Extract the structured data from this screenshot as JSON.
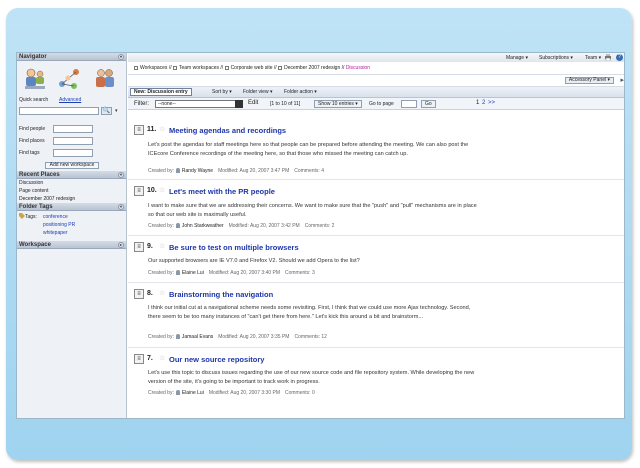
{
  "sidebar": {
    "navigator_title": "Navigator",
    "quick_search_label": "Quick search",
    "advanced_label": "Advanced",
    "search_button": "🔍",
    "find_people": "Find people",
    "find_places": "Find places",
    "find_tags": "Find tags",
    "add_workspace": "Add new workspace",
    "recent_places_title": "Recent Places",
    "recent_places": [
      "Discussion",
      "Page content",
      "December 2007 redesign"
    ],
    "folder_tags_title": "Folder Tags",
    "tags_label": "Tags:",
    "tags": [
      "conference",
      "positioning PR",
      "whitepaper"
    ],
    "workspace_title": "Workspace"
  },
  "topbar": {
    "manage": "Manage ▾",
    "subscriptions": "Subscriptions ▾",
    "team": "Team ▾",
    "help": "?"
  },
  "breadcrumb": {
    "items": [
      "Workspaces",
      "Team workspaces",
      "Corporate web site",
      "December 2007 redesign"
    ],
    "separator": "//",
    "current": "Discussion"
  },
  "accessory_panel": "Accessory Panel ▾",
  "toolbar": {
    "new_entry": "New: Discussion entry",
    "sort_by": "Sort by ▾",
    "folder_view": "Folder view ▾",
    "folder_action": "Folder action ▾"
  },
  "filter": {
    "label": "Filter:",
    "select_value": "--none--",
    "edit": "Edit",
    "range": "[1 to 10 of 11]",
    "show": "Show 10 entries ▾",
    "go_to_page": "Go to page",
    "go_button": "Go",
    "page_current": "1",
    "page_next": "2",
    "page_more": ">>"
  },
  "entries": [
    {
      "num": "11.",
      "title": "Meeting agendas and recordings",
      "body": "Let's post the agendas for staff meetings here so that people can be prepared before attending the meeting. We can also post the ICEcore Conference recordings of the meeting here, so that those who missed the meeting can catch up.",
      "created_by": "Created by:",
      "author": "Randy Wayne",
      "modified": "Modified: Aug 20, 2007 3:47 PM",
      "comments": "Comments: 4"
    },
    {
      "num": "10.",
      "title": "Let's meet with the PR people",
      "body": "I want to make sure that we are addressing their concerns. We want to make sure that the \"push\" and \"pull\" mechanisms are in place so that our web site is maximally useful.",
      "created_by": "Created by:",
      "author": "John Starkweather",
      "modified": "Modified: Aug 20, 2007 3:42 PM",
      "comments": "Comments: 2"
    },
    {
      "num": "9.",
      "title": "Be sure to test on multiple browsers",
      "body": "Our supported browsers are IE V7.0 and Firefox V2. Should we add Opera to the list?",
      "created_by": "Created by:",
      "author": "Elaine Lui",
      "modified": "Modified: Aug 20, 2007 3:40 PM",
      "comments": "Comments: 3"
    },
    {
      "num": "8.",
      "title": "Brainstorming the navigation",
      "body": "I think our initial cut at a navigational scheme needs some revisiting. First, I think that we could use more Ajax technology. Second, there seem to be too many instances of \"can't get there from here.\" Let's kick this around a bit and brainstorm...",
      "created_by": "Created by:",
      "author": "Jamaal Evans",
      "modified": "Modified: Aug 20, 2007 3:35 PM",
      "comments": "Comments: 12"
    },
    {
      "num": "7.",
      "title": "Our new source repository",
      "body": "Let's use this topic to discuss issues regarding the use of our new source code and file repository system. While developing the new version of the site, it's going to be important to track work in progress.",
      "created_by": "Created by:",
      "author": "Elaine Lui",
      "modified": "Modified: Aug 20, 2007 3:30 PM",
      "comments": "Comments: 0"
    }
  ]
}
